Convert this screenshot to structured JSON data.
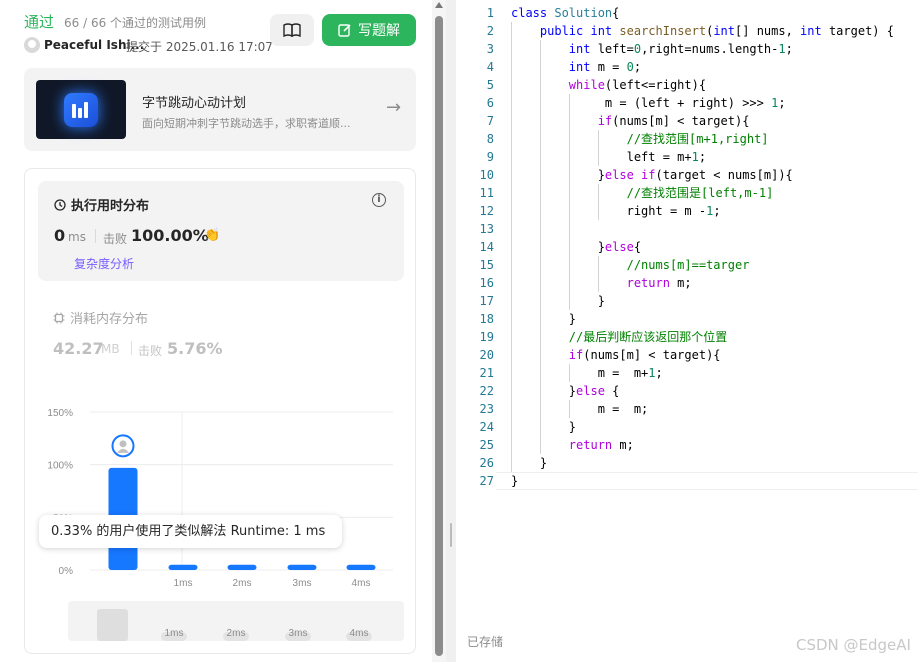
{
  "header": {
    "status": "通过",
    "cases": "66 / 66 个通过的测试用例",
    "author": "Peaceful Ishi...",
    "submitted": "提交于 2025.01.16 17:07",
    "solution_button": "写题解"
  },
  "promo": {
    "title": "字节跳动心动计划",
    "subtitle": "面向短期冲刺字节跳动选手，求职寄道顺..."
  },
  "runtime": {
    "title": "执行用时分布",
    "value": "0",
    "unit": "ms",
    "beats_label": "击败",
    "beats_value": "100.00%",
    "complexity_link": "复杂度分析"
  },
  "memory": {
    "title": "消耗内存分布",
    "value": "42.27",
    "unit": "MB",
    "beats_label": "击败",
    "beats_value": "5.76%"
  },
  "tooltip": "0.33% 的用户使用了类似解法 Runtime: 1 ms",
  "chart_data": {
    "type": "bar",
    "categories": [
      "0ms",
      "1ms",
      "2ms",
      "3ms",
      "4ms"
    ],
    "x_tick_labels": [
      "",
      "1ms",
      "2ms",
      "3ms",
      "4ms"
    ],
    "values": [
      97,
      5,
      5,
      5,
      5
    ],
    "y_ticks": [
      "150%",
      "100%",
      "50%",
      "0%"
    ],
    "ylim": [
      0,
      150
    ],
    "highlight_category": "0ms",
    "overview_tick_labels": [
      "1ms",
      "2ms",
      "3ms",
      "4ms"
    ],
    "bar_color": "#1677ff"
  },
  "editor": {
    "lines": [
      [
        [
          "kw",
          "class "
        ],
        [
          "ty",
          "Solution"
        ],
        [
          "",
          "{"
        ]
      ],
      [
        [
          "",
          "    "
        ],
        [
          "kw",
          "public "
        ],
        [
          "kw",
          "int "
        ],
        [
          "fn",
          "searchInsert"
        ],
        [
          "",
          "("
        ],
        [
          "kw",
          "int"
        ],
        [
          "",
          "[] nums, "
        ],
        [
          "kw",
          "int "
        ],
        [
          "",
          "target) {"
        ]
      ],
      [
        [
          "",
          "        "
        ],
        [
          "kw",
          "int "
        ],
        [
          "",
          "left="
        ],
        [
          "num",
          "0"
        ],
        [
          "",
          ",right=nums.length-"
        ],
        [
          "num",
          "1"
        ],
        [
          "",
          ";"
        ]
      ],
      [
        [
          "",
          "        "
        ],
        [
          "kw",
          "int "
        ],
        [
          "",
          "m = "
        ],
        [
          "num",
          "0"
        ],
        [
          "",
          ";"
        ]
      ],
      [
        [
          "",
          "        "
        ],
        [
          "ctl",
          "while"
        ],
        [
          "",
          "(left<=right){"
        ]
      ],
      [
        [
          "",
          "             m = (left + right) >>> "
        ],
        [
          "num",
          "1"
        ],
        [
          "",
          ";"
        ]
      ],
      [
        [
          "",
          "            "
        ],
        [
          "ctl",
          "if"
        ],
        [
          "",
          "(nums[m] < target){"
        ]
      ],
      [
        [
          "",
          "                "
        ],
        [
          "cm",
          "//查找范围[m+1,right]"
        ]
      ],
      [
        [
          "",
          "                left = m+"
        ],
        [
          "num",
          "1"
        ],
        [
          "",
          ";"
        ]
      ],
      [
        [
          "",
          "            }"
        ],
        [
          "ctl",
          "else if"
        ],
        [
          "",
          "(target < nums[m]){"
        ]
      ],
      [
        [
          "",
          "                "
        ],
        [
          "cm",
          "//查找范围是[left,m-1]"
        ]
      ],
      [
        [
          "",
          "                right = m -"
        ],
        [
          "num",
          "1"
        ],
        [
          "",
          ";"
        ]
      ],
      [
        [
          "",
          ""
        ]
      ],
      [
        [
          "",
          "            }"
        ],
        [
          "ctl",
          "else"
        ],
        [
          "",
          "{"
        ]
      ],
      [
        [
          "",
          "                "
        ],
        [
          "cm",
          "//nums[m]==targer"
        ]
      ],
      [
        [
          "",
          "                "
        ],
        [
          "ctl",
          "return "
        ],
        [
          "",
          "m;"
        ]
      ],
      [
        [
          "",
          "            }"
        ]
      ],
      [
        [
          "",
          "        }"
        ]
      ],
      [
        [
          "",
          "        "
        ],
        [
          "cm",
          "//最后判断应该返回那个位置"
        ]
      ],
      [
        [
          "",
          "        "
        ],
        [
          "ctl",
          "if"
        ],
        [
          "",
          "(nums[m] < target){"
        ]
      ],
      [
        [
          "",
          "            m =  m+"
        ],
        [
          "num",
          "1"
        ],
        [
          "",
          ";"
        ]
      ],
      [
        [
          "",
          "        }"
        ],
        [
          "ctl",
          "else "
        ],
        [
          "",
          "{"
        ]
      ],
      [
        [
          "",
          "            m =  m;"
        ]
      ],
      [
        [
          "",
          "        }"
        ]
      ],
      [
        [
          "",
          "        "
        ],
        [
          "ctl",
          "return "
        ],
        [
          "",
          "m;"
        ]
      ],
      [
        [
          "",
          "    }"
        ]
      ],
      [
        [
          "",
          "}"
        ]
      ]
    ]
  },
  "footer": {
    "saved": "已存储",
    "watermark": "CSDN @EdgeAI"
  },
  "colors": {
    "accent_green": "#2db55d",
    "link_purple": "#7a5cff",
    "bar_blue": "#1677ff"
  }
}
